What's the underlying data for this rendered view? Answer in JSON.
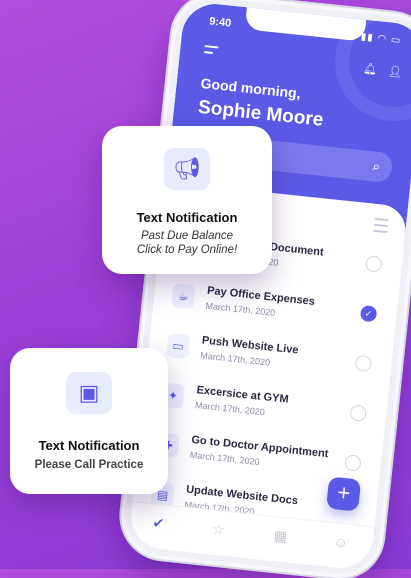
{
  "status_bar": {
    "time": "9:40",
    "icons": "▮▮ ◠ ▭"
  },
  "header": {
    "greeting": "Good morning,",
    "user_name": "Sophie Moore",
    "bell_icon": "bell-icon",
    "user_icon": "user-icon"
  },
  "tasks": [
    {
      "title": "Document",
      "date": "20",
      "done": false,
      "icon": "document-icon"
    },
    {
      "title": "Pay Office Expenses",
      "date": "March 17th, 2020",
      "done": true,
      "icon": "cup-icon"
    },
    {
      "title": "Push Website Live",
      "date": "March 17th, 2020",
      "done": false,
      "icon": "monitor-icon"
    },
    {
      "title": "Excersice at GYM",
      "date": "March 17th, 2020",
      "done": false,
      "icon": "dumbbell-icon"
    },
    {
      "title": "Go to Doctor Appointment",
      "date": "March 17th, 2020",
      "done": false,
      "icon": "doctor-icon"
    },
    {
      "title": "Update Website Docs",
      "date": "March 17th, 2020",
      "done": false,
      "icon": "docs-icon"
    }
  ],
  "fab_label": "+",
  "tabs": [
    "check-tab",
    "star-tab",
    "calendar-tab",
    "profile-tab"
  ],
  "cards": [
    {
      "title": "Text Notification",
      "line1": "Past Due Balance",
      "line2": "Click to Pay Online!",
      "icon": "megaphone-icon"
    },
    {
      "title": "Text Notification",
      "line1": "Please Call Practice",
      "icon": "browser-window-icon"
    }
  ],
  "colors": {
    "accent": "#5b5ae6",
    "background": "#9b3fd8"
  }
}
